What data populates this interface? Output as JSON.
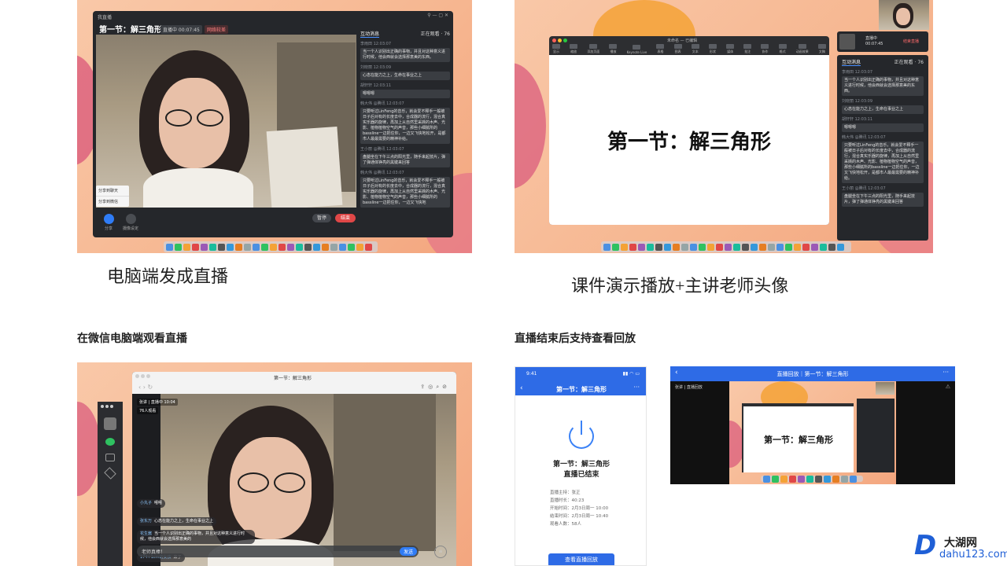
{
  "panel1": {
    "window_title": "我直播",
    "lesson_title": "第一节：解三角形",
    "status": "直播中 00:07:45",
    "warn_badge": "网络较差",
    "tabs": [
      "互动消息",
      "正在观看 · 76"
    ],
    "messages": [
      {
        "user": "李雨田 12:03:07",
        "text": "当一个人识别出正确的事物，并且对这种意义进行时候，他会西就会选择那意美的东西。"
      },
      {
        "user": "刘晓丽 12:03:09",
        "text": "心态在能力之上，生命在事业之上"
      },
      {
        "user": "胡轩轩 12:03:11",
        "text": "嗯嗯嗯"
      },
      {
        "user": "韩大伟 @腾讯 12:03:07",
        "text": "只要听过LinFeng的音乐，就会爱不释手一般被日子后对有的长度去中，合成器的流行，混合真实乐器的旋律，再加上从自然里采撷的木声、光影、植物植物空气的声音，那些小细腻所的bassline一边把住你，一边又飞快地松开，是都市人最最需要的精神补给。"
      },
      {
        "user": "王小丽 @腾讯 12:03:07",
        "text": "盘腿坐在下午三点的阳光里，随手来起技片，弹了弹通体铮亮的黑键来回答"
      },
      {
        "user": "韩大伟 @腾讯 12:03:07",
        "text": "只要听过LinFeng的音乐，就会爱不释手一般被日子后对有的长度去中，合成器的流行，混合真实乐器的旋律，再加上从自然里采撷的木声、光影、植物植物空气的声音，那些小细腻所的bassline一边把住你，一边又飞快地"
      }
    ],
    "share_menu": [
      "分享到聊天",
      "分享到微信"
    ],
    "bottom_icons": [
      "分享",
      "摄像设定"
    ],
    "pause_label": "暂停",
    "end_label": "结束"
  },
  "caption1": "电脑端发成直播",
  "panel2": {
    "app_title": "未命名 — 已编辑",
    "toolbar_items": [
      "显示",
      "缩放",
      "添加页面",
      "播放",
      "Keynote Live",
      "表格",
      "图表",
      "文本",
      "形状",
      "媒体",
      "批注",
      "协作",
      "格式",
      "动画效果",
      "文稿"
    ],
    "slide_title": "第一节：解三角形",
    "status": "直播中",
    "timer": "00:07:45",
    "end_live": "结束直播",
    "tabs": [
      "互动消息",
      "正在观看 · 76"
    ],
    "messages": [
      {
        "user": "李雨田 12:03:07",
        "text": "当一个人识别出正确的事物，并且对这种意义进行时候，他会西就会选择那意美的东西。"
      },
      {
        "user": "刘晓丽 12:03:09",
        "text": "心态在能力之上，生命在事业之上"
      },
      {
        "user": "胡轩轩 12:03:11",
        "text": "嗯嗯嗯"
      },
      {
        "user": "韩大伟 @腾讯 12:03:07",
        "text": "只要听过LinFeng的音乐，就会爱不释手一般被日子后对有的长度去中，合成器的流行，混合真实乐器的旋律，再加上从自然里采撷的木声、光影、植物植物空气的声音，那些小细腻所的bassline一边把住你，一边又飞快地松开，是都市人最最需要的精神补给。"
      },
      {
        "user": "王小丽 @腾讯 12:03:07",
        "text": "盘腿坐在下午三点的阳光里，随手来起技片，弹了弹通体铮亮的黑键来回答"
      }
    ]
  },
  "caption2": "课件演示播放+主讲老师头像",
  "section3": "在微信电脑端观看直播",
  "section4": "直播结束后支持查看回放",
  "panel3": {
    "window_title": "第一节：解三角形",
    "host_line": "张讲 | 直播中 10:04",
    "viewers": "76人观看",
    "comments": [
      {
        "user": "小丸子",
        "text": "嘻嘻"
      },
      {
        "user": "张东万",
        "text": "心态在能力之上，生命在事业之上"
      },
      {
        "user": "花生酱",
        "text": "当一个人识别出正确的事物，并且对这种意义进行时候，他会西就会选择那意美的"
      },
      {
        "user": "174+1cm的女孩",
        "text": "来了"
      }
    ],
    "input_placeholder": "老师真棒！",
    "send": "发送"
  },
  "panel4": {
    "time": "9:41",
    "title": "第一节：解三角形",
    "ended_title": "第一节：解三角形",
    "ended_sub": "直播已结束",
    "details": [
      "直播主持：张正",
      "直播时长：40:23",
      "开始时间：2月3日周一 10:00",
      "结束时间：2月3日周一 10:40",
      "观看人数：58人"
    ],
    "replay_button": "查看直播回放"
  },
  "panel5": {
    "title": "直播回放｜第一节：解三角形",
    "host_line": "张讲 | 直播回放",
    "slide_title": "第一节：解三角形"
  },
  "watermark": {
    "logo_letter": "D",
    "name": "大湖网",
    "url": "dahu123.com"
  }
}
